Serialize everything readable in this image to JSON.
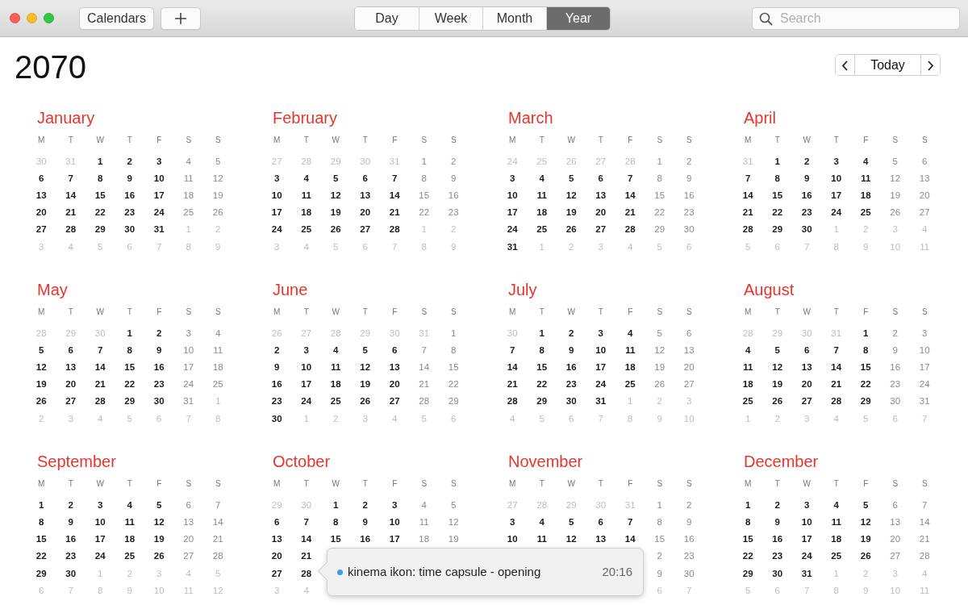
{
  "toolbar": {
    "calendars_button": "Calendars",
    "view_tabs": [
      {
        "label": "Day",
        "selected": false
      },
      {
        "label": "Week",
        "selected": false
      },
      {
        "label": "Month",
        "selected": false
      },
      {
        "label": "Year",
        "selected": true
      }
    ],
    "search": {
      "placeholder": "Search"
    }
  },
  "year_title": "2070",
  "today_button": "Today",
  "months": [
    {
      "name": "January",
      "weekdays": [
        "M",
        "T",
        "W",
        "T",
        "F",
        "S",
        "S"
      ],
      "leading": [
        "30",
        "31"
      ],
      "days": [
        "1",
        "2",
        "3",
        "4",
        "5",
        "6",
        "7",
        "8",
        "9",
        "10",
        "11",
        "12",
        "13",
        "14",
        "15",
        "16",
        "17",
        "18",
        "19",
        "20",
        "21",
        "22",
        "23",
        "24",
        "25",
        "26",
        "27",
        "28",
        "29",
        "30",
        "31"
      ],
      "trailing": [
        "1",
        "2",
        "3",
        "4",
        "5",
        "6",
        "7",
        "8",
        "9"
      ]
    },
    {
      "name": "February",
      "weekdays": [
        "M",
        "T",
        "W",
        "T",
        "F",
        "S",
        "S"
      ],
      "leading": [
        "27",
        "28",
        "29",
        "30",
        "31"
      ],
      "days": [
        "1",
        "2",
        "3",
        "4",
        "5",
        "6",
        "7",
        "8",
        "9",
        "10",
        "11",
        "12",
        "13",
        "14",
        "15",
        "16",
        "17",
        "18",
        "19",
        "20",
        "21",
        "22",
        "23",
        "24",
        "25",
        "26",
        "27",
        "28"
      ],
      "trailing": [
        "1",
        "2",
        "3",
        "4",
        "5",
        "6",
        "7",
        "8",
        "9"
      ]
    },
    {
      "name": "March",
      "weekdays": [
        "M",
        "T",
        "W",
        "T",
        "F",
        "S",
        "S"
      ],
      "leading": [
        "24",
        "25",
        "26",
        "27",
        "28"
      ],
      "days": [
        "1",
        "2",
        "3",
        "4",
        "5",
        "6",
        "7",
        "8",
        "9",
        "10",
        "11",
        "12",
        "13",
        "14",
        "15",
        "16",
        "17",
        "18",
        "19",
        "20",
        "21",
        "22",
        "23",
        "24",
        "25",
        "26",
        "27",
        "28",
        "29",
        "30",
        "31"
      ],
      "trailing": [
        "1",
        "2",
        "3",
        "4",
        "5",
        "6"
      ]
    },
    {
      "name": "April",
      "weekdays": [
        "M",
        "T",
        "W",
        "T",
        "F",
        "S",
        "S"
      ],
      "leading": [
        "31"
      ],
      "days": [
        "1",
        "2",
        "3",
        "4",
        "5",
        "6",
        "7",
        "8",
        "9",
        "10",
        "11",
        "12",
        "13",
        "14",
        "15",
        "16",
        "17",
        "18",
        "19",
        "20",
        "21",
        "22",
        "23",
        "24",
        "25",
        "26",
        "27",
        "28",
        "29",
        "30"
      ],
      "trailing": [
        "1",
        "2",
        "3",
        "4",
        "5",
        "6",
        "7",
        "8",
        "9",
        "10",
        "11"
      ]
    },
    {
      "name": "May",
      "weekdays": [
        "M",
        "T",
        "W",
        "T",
        "F",
        "S",
        "S"
      ],
      "leading": [
        "28",
        "29",
        "30"
      ],
      "days": [
        "1",
        "2",
        "3",
        "4",
        "5",
        "6",
        "7",
        "8",
        "9",
        "10",
        "11",
        "12",
        "13",
        "14",
        "15",
        "16",
        "17",
        "18",
        "19",
        "20",
        "21",
        "22",
        "23",
        "24",
        "25",
        "26",
        "27",
        "28",
        "29",
        "30",
        "31"
      ],
      "trailing": [
        "1",
        "2",
        "3",
        "4",
        "5",
        "6",
        "7",
        "8"
      ]
    },
    {
      "name": "June",
      "weekdays": [
        "M",
        "T",
        "W",
        "T",
        "F",
        "S",
        "S"
      ],
      "leading": [
        "26",
        "27",
        "28",
        "29",
        "30",
        "31"
      ],
      "days": [
        "1",
        "2",
        "3",
        "4",
        "5",
        "6",
        "7",
        "8",
        "9",
        "10",
        "11",
        "12",
        "13",
        "14",
        "15",
        "16",
        "17",
        "18",
        "19",
        "20",
        "21",
        "22",
        "23",
        "24",
        "25",
        "26",
        "27",
        "28",
        "29",
        "30"
      ],
      "trailing": [
        "1",
        "2",
        "3",
        "4",
        "5",
        "6"
      ]
    },
    {
      "name": "July",
      "weekdays": [
        "M",
        "T",
        "W",
        "T",
        "F",
        "S",
        "S"
      ],
      "leading": [
        "30"
      ],
      "days": [
        "1",
        "2",
        "3",
        "4",
        "5",
        "6",
        "7",
        "8",
        "9",
        "10",
        "11",
        "12",
        "13",
        "14",
        "15",
        "16",
        "17",
        "18",
        "19",
        "20",
        "21",
        "22",
        "23",
        "24",
        "25",
        "26",
        "27",
        "28",
        "29",
        "30",
        "31"
      ],
      "trailing": [
        "1",
        "2",
        "3",
        "4",
        "5",
        "6",
        "7",
        "8",
        "9",
        "10"
      ]
    },
    {
      "name": "August",
      "weekdays": [
        "M",
        "T",
        "W",
        "T",
        "F",
        "S",
        "S"
      ],
      "leading": [
        "28",
        "29",
        "30",
        "31"
      ],
      "days": [
        "1",
        "2",
        "3",
        "4",
        "5",
        "6",
        "7",
        "8",
        "9",
        "10",
        "11",
        "12",
        "13",
        "14",
        "15",
        "16",
        "17",
        "18",
        "19",
        "20",
        "21",
        "22",
        "23",
        "24",
        "25",
        "26",
        "27",
        "28",
        "29",
        "30",
        "31"
      ],
      "trailing": [
        "1",
        "2",
        "3",
        "4",
        "5",
        "6",
        "7"
      ]
    },
    {
      "name": "September",
      "weekdays": [
        "M",
        "T",
        "W",
        "T",
        "F",
        "S",
        "S"
      ],
      "days": [
        "1",
        "2",
        "3",
        "4",
        "5",
        "6",
        "7",
        "8",
        "9",
        "10",
        "11",
        "12",
        "13",
        "14",
        "15",
        "16",
        "17",
        "18",
        "19",
        "20",
        "21",
        "22",
        "23",
        "24",
        "25",
        "26",
        "27",
        "28",
        "29",
        "30"
      ],
      "trailing": [
        "1",
        "2",
        "3",
        "4",
        "5",
        "6",
        "7",
        "8",
        "9",
        "10",
        "11",
        "12"
      ]
    },
    {
      "name": "October",
      "weekdays": [
        "M",
        "T",
        "W",
        "T",
        "F",
        "S",
        "S"
      ],
      "leading": [
        "29",
        "30"
      ],
      "days": [
        "1",
        "2",
        "3",
        "4",
        "5",
        "6",
        "7",
        "8",
        "9",
        "10",
        "11",
        "12",
        "13",
        "14",
        "15",
        "16",
        "17",
        "18",
        "19",
        "20",
        "21",
        "27",
        "28"
      ],
      "trailing": [
        "3",
        "4"
      ]
    },
    {
      "name": "November",
      "weekdays": [
        "M",
        "T",
        "W",
        "T",
        "F",
        "S",
        "S"
      ],
      "leading": [
        "27",
        "28",
        "29",
        "30",
        "31"
      ],
      "days": [
        "1",
        "2",
        "3",
        "4",
        "5",
        "6",
        "7",
        "8",
        "9",
        "10",
        "11",
        "12",
        "13",
        "14",
        "15",
        "16",
        "2",
        "23",
        "9",
        "30"
      ],
      "trailing": [
        "6",
        "7"
      ]
    },
    {
      "name": "December",
      "weekdays": [
        "M",
        "T",
        "W",
        "T",
        "F",
        "S",
        "S"
      ],
      "days": [
        "1",
        "2",
        "3",
        "4",
        "5",
        "6",
        "7",
        "8",
        "9",
        "10",
        "11",
        "12",
        "13",
        "14",
        "15",
        "16",
        "17",
        "18",
        "19",
        "20",
        "21",
        "22",
        "23",
        "24",
        "25",
        "26",
        "27",
        "28",
        "29",
        "30",
        "31"
      ],
      "trailing": [
        "1",
        "2",
        "3",
        "4",
        "5",
        "6",
        "7",
        "8",
        "9",
        "10",
        "11"
      ]
    }
  ],
  "event_popover": {
    "title": "kinema ikon: time capsule - opening",
    "time": "20:16",
    "color": "#3b9cf0"
  }
}
